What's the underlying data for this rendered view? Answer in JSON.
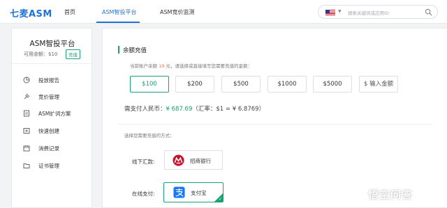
{
  "nav": {
    "logo": "七麦ASM",
    "items": [
      "首页",
      "ASM智投平台",
      "ASM竞价监测"
    ],
    "active_index": 1,
    "search_placeholder": "搜索关键词或应用ID"
  },
  "sidebar": {
    "title": "ASM智投平台",
    "balance": "可用余额：$10",
    "recharge_label": "充值",
    "items": [
      {
        "label": "投放报告",
        "icon": "report-icon"
      },
      {
        "label": "竞价管理",
        "icon": "bid-icon"
      },
      {
        "label": "ASM扩词方案",
        "icon": "document-icon"
      },
      {
        "label": "快速创建",
        "icon": "create-icon"
      },
      {
        "label": "消费记录",
        "icon": "record-icon"
      },
      {
        "label": "证书管理",
        "icon": "folder-icon"
      }
    ]
  },
  "main": {
    "section_title": "余额充值",
    "hint_prefix": "当前账户余额",
    "hint_value": "10",
    "hint_suffix": "元，请选择或直接填写您需要充值的金额：",
    "amounts": [
      "$100",
      "$200",
      "$500",
      "$1000",
      "$5000"
    ],
    "selected_amount_index": 0,
    "custom_amount": "$ 输入金额",
    "pay_label": "需支付人民币：",
    "pay_value": "¥ 687.69",
    "pay_rate": "（汇率：$1 = ¥ 6.8769）",
    "method_hint": "选择您需要充值的方式：",
    "offline_label": "线下汇款:",
    "bank_name": "招商银行",
    "online_label": "在线支付:",
    "alipay_name": "支付宝"
  },
  "watermark": {
    "text": "悟空问答"
  },
  "colors": {
    "brand_blue": "#1f73d6",
    "accent_green": "#15a374",
    "highlight_orange": "#ef6c3c"
  }
}
